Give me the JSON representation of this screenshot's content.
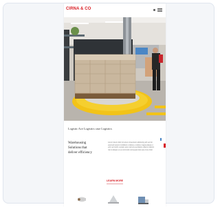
{
  "window": {
    "title": ""
  },
  "brand": {
    "name": "CIRNA & CO",
    "accent_color": "#d71920"
  },
  "header": {
    "menu_icon": "hamburger-icon"
  },
  "hero": {
    "subject": "wrapped cardboard box pallet on yellow turntable"
  },
  "content": {
    "intro": "Logistic Ace Logistics case Logistics",
    "left_column": "Warehousing Solutions that deliver efficiency",
    "right_column": "Lorem ipsum dolor sit amet consectetur adipiscing elit sed do eiusmod tempor incididunt ut labore et dolore magna aliqua ut enim ad minim veniam quis nostrud exercitation ullamco laboris nisi ut aliquip ex ea commodo consequat duis aute irure dolor",
    "cta": "LEARN MORE"
  },
  "products": {
    "icons": [
      "stretch-film-roll-icon",
      "pallet-wrap-icon",
      "packaging-machine-icon"
    ]
  }
}
